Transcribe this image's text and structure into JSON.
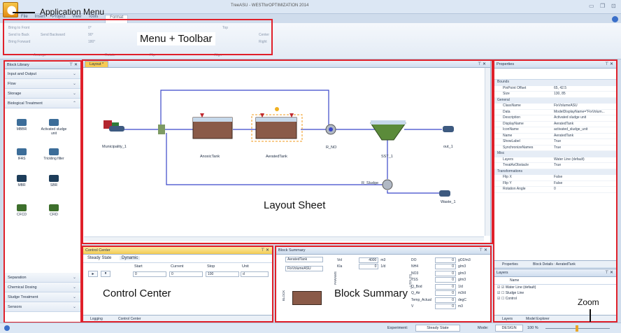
{
  "window": {
    "title": "TreeASU - WESTforOPTIMIZATION 2014"
  },
  "menu_tabs": [
    "File",
    "Insert",
    "Project",
    "View",
    "Tools",
    "Format"
  ],
  "ribbon": {
    "items": [
      "Bring to Front",
      "Send to Back",
      "Send Backward",
      "Bring Forward",
      "0°",
      "90°",
      "180°",
      "Top",
      "Center",
      "Right"
    ],
    "groups": [
      "Arrange",
      "Rotate",
      "Flip",
      "Align"
    ]
  },
  "block_library": {
    "title": "Block Library",
    "sections_top": [
      "Input and Output",
      "Flow",
      "Storage",
      "Biological Treatment"
    ],
    "items": [
      "MBBR",
      "Activated sludge unit",
      "IFAS",
      "Trickling filter",
      "MBR",
      "SBR",
      "CFCD",
      "CFID"
    ],
    "sections_bottom": [
      "Separation",
      "Chemical Dosing",
      "Sludge Treatment",
      "Sensors"
    ]
  },
  "layout": {
    "tab": "Layout *",
    "labels": [
      "Municipality_1",
      "AnoxicTank",
      "AeratedTank",
      "R_NO",
      "SST_1",
      "out_1",
      "R_Sludge",
      "Waste_1"
    ]
  },
  "properties": {
    "title": "Properties",
    "rows": [
      {
        "cat": "Bounds"
      },
      {
        "k": "PinPoint Offset",
        "v": "65, 42.5"
      },
      {
        "k": "Size",
        "v": "130, 85"
      },
      {
        "cat": "General"
      },
      {
        "k": "ClassName",
        "v": "FixVolumeASU"
      },
      {
        "k": "Data",
        "v": "ModelDisplayName=\"FixVolum..."
      },
      {
        "k": "Description",
        "v": "Activated sludge unit"
      },
      {
        "k": "DisplayName",
        "v": "AeratedTank"
      },
      {
        "k": "IconName",
        "v": "activated_sludge_unit"
      },
      {
        "k": "Name",
        "v": "AeratedTank"
      },
      {
        "k": "ShowLabel",
        "v": "True"
      },
      {
        "k": "SynchronizeNames",
        "v": "True"
      },
      {
        "cat": "Misc"
      },
      {
        "k": "Layers",
        "v": "Water Line (default)"
      },
      {
        "k": "TreatAsObstacle",
        "v": "True"
      },
      {
        "cat": "Transformations"
      },
      {
        "k": "Flip X",
        "v": "False"
      },
      {
        "k": "Flip Y",
        "v": "False"
      },
      {
        "k": "Rotation Angle",
        "v": "0"
      }
    ],
    "tabs": [
      "Properties",
      "Block Details : AeratedTank"
    ]
  },
  "layers": {
    "title": "Layers",
    "col_name": "Name",
    "rows": [
      "Water Line (default)",
      "Sludge Line",
      "Control"
    ],
    "tabs": [
      "Layers",
      "Model Explorer"
    ]
  },
  "control_center": {
    "title": "Control Center",
    "tabs": [
      "Steady State",
      "Dynamic"
    ],
    "headers": [
      "Start",
      "Current",
      "Stop",
      "Unit"
    ],
    "values": [
      "0",
      "0",
      "100",
      "d"
    ],
    "bottom_tabs": [
      "Logging",
      "Control Center"
    ]
  },
  "block_summary": {
    "title": "Block Summary",
    "names": [
      "AeratedTank",
      "FixVolumeASU"
    ],
    "params": [
      {
        "k": "Vol",
        "v": "4000",
        "u": "m3"
      },
      {
        "k": "Kla",
        "v": "0",
        "u": "1/d"
      }
    ],
    "outputs": [
      {
        "k": "DO",
        "v": "0",
        "u": "gO2/m3"
      },
      {
        "k": "NH4",
        "v": "0",
        "u": "g/m3"
      },
      {
        "k": "NO3",
        "v": "0",
        "u": "g/m3"
      },
      {
        "k": "TSS",
        "v": "0",
        "u": "g/m3"
      },
      {
        "k": "Q_Bod",
        "v": "0",
        "u": "1/d"
      },
      {
        "k": "Q_Air",
        "v": "0",
        "u": "m3/d"
      },
      {
        "k": "Temp_Actual",
        "v": "0",
        "u": "degC"
      },
      {
        "k": "V",
        "v": "0",
        "u": "m3"
      }
    ],
    "side_labels": [
      "BLOCK",
      "PARAMS",
      "OUTPUTS"
    ]
  },
  "status": {
    "experiment_label": "Experiment:",
    "experiment_value": "Steady State",
    "mode_label": "Mode:",
    "mode_value": "DESIGN",
    "zoom": "100 %"
  },
  "annotations": {
    "app_menu": "Application Menu",
    "menu_toolbar": "Menu + Toolbar",
    "layout_sheet": "Layout Sheet",
    "control_center": "Control Center",
    "block_summary": "Block Summary",
    "zoom": "Zoom"
  },
  "colors": {
    "annotation": "#e0202a",
    "flow_line": "#3a47c9",
    "panel_border": "#9fb3cc"
  }
}
